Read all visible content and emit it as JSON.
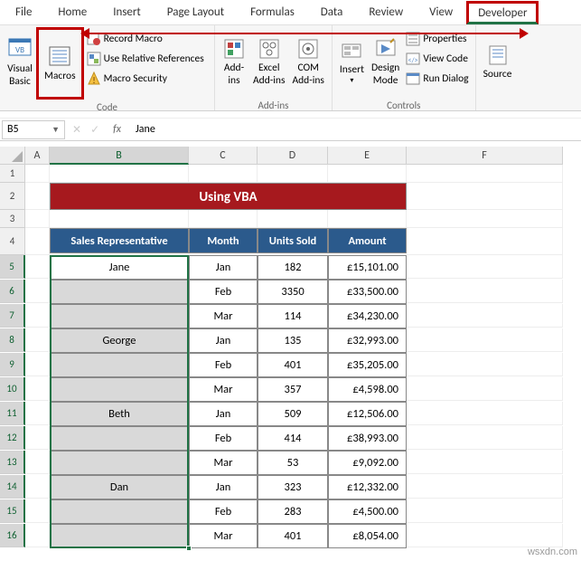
{
  "ribbon": {
    "tabs": [
      "File",
      "Home",
      "Insert",
      "Page Layout",
      "Formulas",
      "Data",
      "Review",
      "View",
      "Developer"
    ],
    "active_tab": "Developer",
    "groups": {
      "code": {
        "label": "Code",
        "visual_basic": "Visual\nBasic",
        "macros": "Macros",
        "record_macro": "Record Macro",
        "use_relative": "Use Relative References",
        "macro_security": "Macro Security"
      },
      "addins": {
        "label": "Add-ins",
        "addins": "Add-\nins",
        "excel_addins": "Excel\nAdd-ins",
        "com_addins": "COM\nAdd-ins"
      },
      "controls": {
        "label": "Controls",
        "insert": "Insert",
        "design_mode": "Design\nMode",
        "properties": "Properties",
        "view_code": "View Code",
        "run_dialog": "Run Dialog"
      },
      "xml": {
        "source": "Source"
      }
    }
  },
  "formula_bar": {
    "name_box": "B5",
    "fx": "fx",
    "value": "Jane"
  },
  "columns": [
    "",
    "A",
    "B",
    "C",
    "D",
    "E",
    "F"
  ],
  "title": "Using VBA",
  "headers": {
    "rep": "Sales Representative",
    "month": "Month",
    "units": "Units Sold",
    "amount": "Amount"
  },
  "chart_data": {
    "type": "table",
    "title": "Using VBA",
    "columns": [
      "Sales Representative",
      "Month",
      "Units Sold",
      "Amount"
    ],
    "rows": [
      {
        "rep": "Jane",
        "month": "Jan",
        "units": 182,
        "amount": "£15,101.00"
      },
      {
        "rep": "",
        "month": "Feb",
        "units": 3350,
        "amount": "£33,500.00"
      },
      {
        "rep": "",
        "month": "Mar",
        "units": 114,
        "amount": "£34,230.00"
      },
      {
        "rep": "George",
        "month": "Jan",
        "units": 135,
        "amount": "£32,993.00"
      },
      {
        "rep": "",
        "month": "Feb",
        "units": 401,
        "amount": "£35,205.00"
      },
      {
        "rep": "",
        "month": "Mar",
        "units": 357,
        "amount": "£4,598.00"
      },
      {
        "rep": "Beth",
        "month": "Jan",
        "units": 509,
        "amount": "£12,506.00"
      },
      {
        "rep": "",
        "month": "Feb",
        "units": 414,
        "amount": "£38,993.00"
      },
      {
        "rep": "",
        "month": "Mar",
        "units": 53,
        "amount": "£9,092.00"
      },
      {
        "rep": "Dan",
        "month": "Jan",
        "units": 323,
        "amount": "£12,332.00"
      },
      {
        "rep": "",
        "month": "Feb",
        "units": 283,
        "amount": "£4,500.00"
      },
      {
        "rep": "",
        "month": "Mar",
        "units": 401,
        "amount": "£8,054.00"
      }
    ]
  },
  "watermark": "wsxdn.com"
}
